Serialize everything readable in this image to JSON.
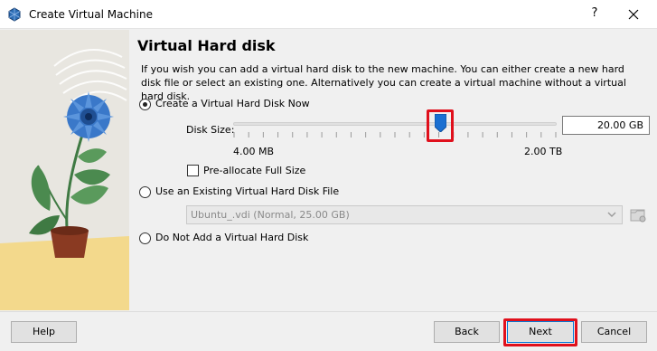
{
  "window": {
    "title": "Create Virtual Machine",
    "help_glyph": "?"
  },
  "page": {
    "heading": "Virtual Hard disk",
    "description": "If you wish you can add a virtual hard disk to the new machine. You can either create a new hard disk file or select an existing one. Alternatively you can create a virtual machine without a virtual hard disk."
  },
  "options": {
    "create_now": {
      "label": "Create a Virtual Hard Disk Now",
      "selected": true
    },
    "use_existing": {
      "label": "Use an Existing Virtual Hard Disk File",
      "selected": false
    },
    "no_disk": {
      "label": "Do Not Add a Virtual Hard Disk",
      "selected": false
    }
  },
  "disk_size": {
    "label": "Disk Size:",
    "value": "20.00 GB",
    "min_label": "4.00 MB",
    "max_label": "2.00 TB",
    "slider_fraction": 0.64
  },
  "preallocate": {
    "label": "Pre-allocate Full Size",
    "checked": false
  },
  "existing_file": {
    "selected_value": "Ubuntu_.vdi (Normal, 25.00 GB)"
  },
  "buttons": {
    "help": "Help",
    "back": "Back",
    "next": "Next",
    "cancel": "Cancel"
  },
  "colors": {
    "highlight": "#e0101c",
    "slider_handle": "#1a6fd1",
    "flower_blue": "#3a78c9"
  }
}
